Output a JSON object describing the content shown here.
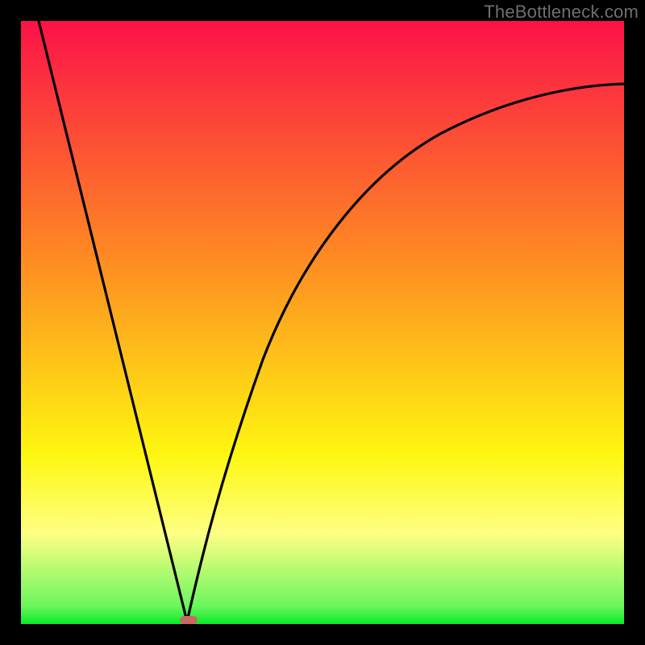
{
  "watermark": "TheBottleneck.com",
  "colors": {
    "frame": "#000000",
    "curve": "#000000",
    "marker": "#c96762",
    "gradient_top": "#fb1248",
    "gradient_mid1": "#fe8d22",
    "gradient_mid2": "#fef710",
    "gradient_mid3": "#feff84",
    "gradient_bottom": "#07eb29"
  },
  "chart_data": {
    "type": "line",
    "title": "",
    "xlabel": "",
    "ylabel": "",
    "xlim": [
      0,
      100
    ],
    "ylim": [
      0,
      100
    ],
    "grid": false,
    "legend": null,
    "series": [
      {
        "name": "bottleneck-curve-left",
        "comment": "steep near-linear descent from top-left to the minimum",
        "x": [
          3,
          6,
          9,
          12,
          15,
          18,
          21,
          24,
          26,
          27.5
        ],
        "values": [
          100,
          88,
          76,
          63,
          51,
          39,
          27,
          15,
          6,
          0
        ]
      },
      {
        "name": "bottleneck-curve-right",
        "comment": "rising decelerating curve from the minimum toward upper-right",
        "x": [
          27.5,
          30,
          33,
          36,
          40,
          45,
          50,
          55,
          60,
          65,
          70,
          75,
          80,
          85,
          90,
          95,
          100
        ],
        "values": [
          0,
          11,
          24,
          34,
          45,
          55,
          62,
          68,
          72.5,
          76,
          79,
          81.5,
          83.5,
          85,
          86.5,
          87.8,
          89
        ]
      }
    ],
    "marker": {
      "x": 27.5,
      "y": 0,
      "shape": "rounded-rect",
      "color": "#c96762"
    },
    "background_gradient": {
      "direction": "vertical",
      "stops": [
        {
          "pos": 0.0,
          "color": "#fb1248"
        },
        {
          "pos": 0.4,
          "color": "#fe8d22"
        },
        {
          "pos": 0.72,
          "color": "#fef710"
        },
        {
          "pos": 0.85,
          "color": "#feff84"
        },
        {
          "pos": 0.97,
          "color": "#6cf65e"
        },
        {
          "pos": 1.0,
          "color": "#07eb29"
        }
      ]
    }
  }
}
